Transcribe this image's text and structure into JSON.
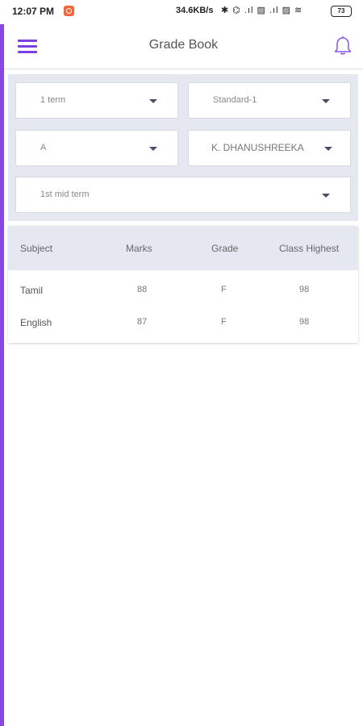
{
  "status_bar": {
    "time": "12:07 PM",
    "speed": "34.6KB/s",
    "icons": "✱ ⌬ .ıl ▨ .ıl ▨ ≋",
    "battery": "73"
  },
  "header": {
    "title": "Grade Book",
    "menu_icon": "hamburger-menu-icon",
    "bell_icon": "bell-icon"
  },
  "filters": {
    "term": "1 term",
    "standard": "Standard-1",
    "section": "A",
    "student": "K. DHANUSHREEKA",
    "exam": "1st mid term"
  },
  "table": {
    "headers": [
      "Subject",
      "Marks",
      "Grade",
      "Class Highest"
    ],
    "rows": [
      {
        "subject": "Tamil",
        "marks": "88",
        "grade": "F",
        "highest": "98"
      },
      {
        "subject": "English",
        "marks": "87",
        "grade": "F",
        "highest": "98"
      }
    ]
  },
  "colors": {
    "accent": "#7b3fe4",
    "panel": "#e6e8f1"
  }
}
